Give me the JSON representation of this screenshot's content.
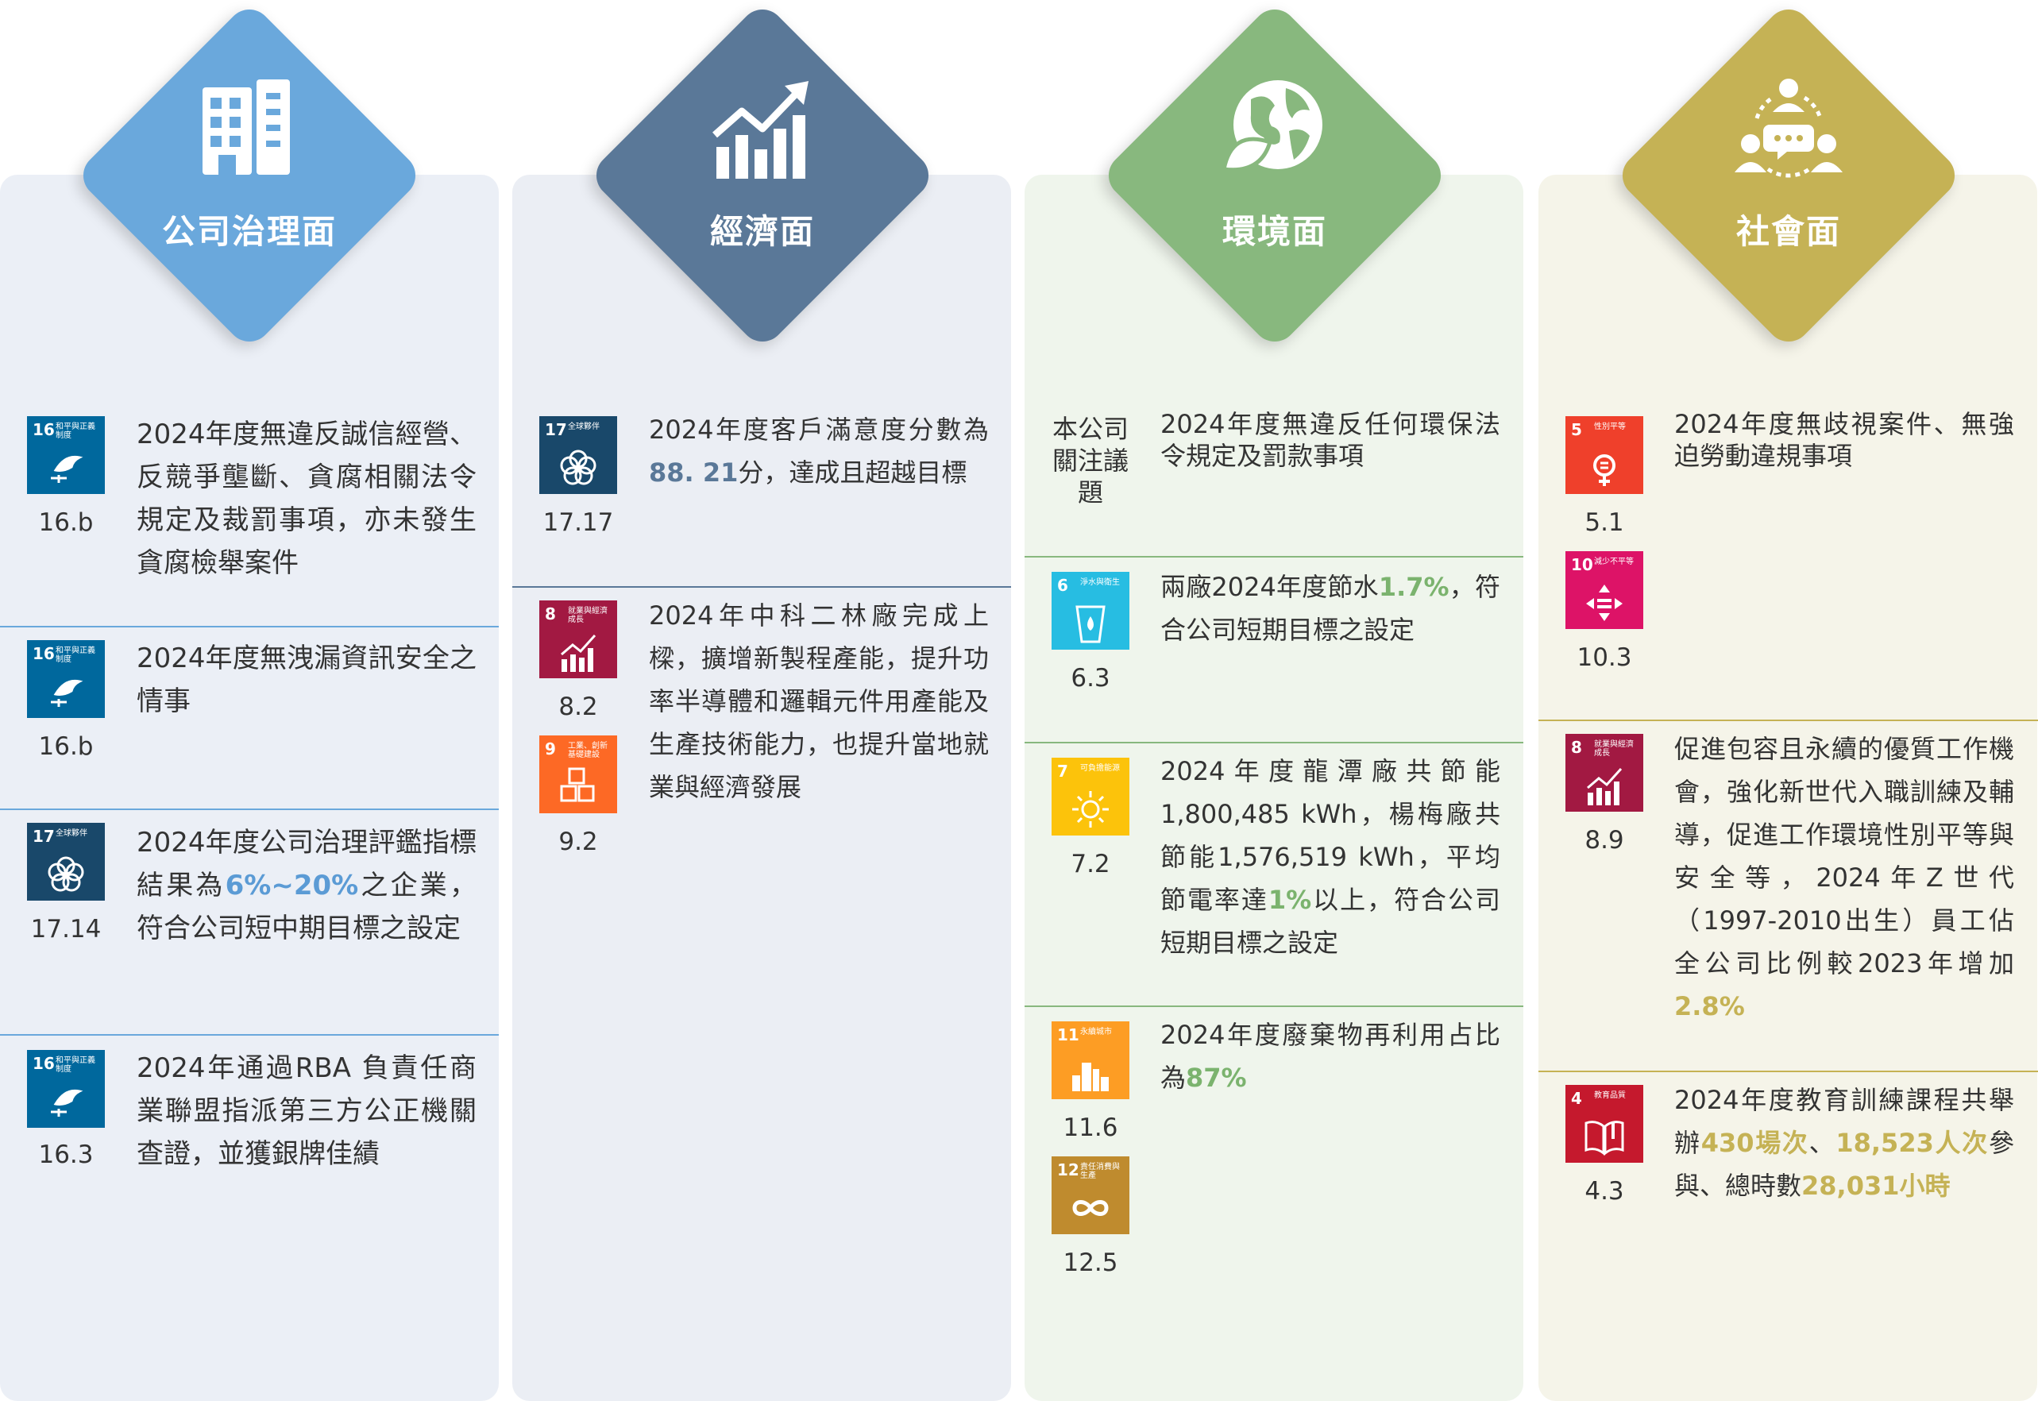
{
  "colors": {
    "governance": "#6aa8dc",
    "economy": "#5a7898",
    "environment": "#88b87e",
    "society": "#c5b255",
    "panel_gov": "#ebeff6",
    "panel_econ": "#ebeef4",
    "panel_env": "#eff5ec",
    "panel_soc": "#f5f4e9",
    "sdg4": "#c5192d",
    "sdg5": "#ef402b",
    "sdg6": "#27bde2",
    "sdg7": "#fcc30b",
    "sdg8": "#a21942",
    "sdg9": "#fd6925",
    "sdg10": "#dd1367",
    "sdg11": "#fd9d24",
    "sdg12": "#bf8b2e",
    "sdg16": "#00689d",
    "sdg17": "#19486a"
  },
  "columns": {
    "governance": {
      "title": "公司治理面",
      "icon": "building-icon",
      "items": [
        {
          "text_pre": "2024年度無違反誠信經營、反競爭壟斷、貪腐相關法令規定及裁罰事項，亦未發生貪腐檢舉案件",
          "code": "16.b",
          "badge": {
            "num": "16",
            "name": "和平與正義制度"
          }
        },
        {
          "text_pre": "2024年度無洩漏資訊安全之情事",
          "code": "16.b",
          "badge": {
            "num": "16",
            "name": "和平與正義制度"
          }
        },
        {
          "text_pre": "2024年度公司治理評鑑指標結果為",
          "highlight": "6%~20%",
          "text_post": "之企業，符合公司短中期目標之設定",
          "code": "17.14",
          "badge": {
            "num": "17",
            "name": "全球夥伴"
          }
        },
        {
          "text_pre": "2024年通過RBA 負責任商業聯盟指派第三方公正機關查證，並獲銀牌佳績",
          "code": "16.3",
          "badge": {
            "num": "16",
            "name": "和平與正義制度"
          }
        }
      ]
    },
    "economy": {
      "title": "經濟面",
      "icon": "growth-chart-icon",
      "items": [
        {
          "text_pre": "2024年度客戶滿意度分數為",
          "highlight": "88. 21",
          "text_post": "分，達成且超越目標",
          "codes": [
            "17.17"
          ],
          "badges": [
            {
              "num": "17",
              "name": "全球夥伴"
            }
          ]
        },
        {
          "text_pre": "2024年中科二林廠完成上樑，擴增新製程產能，提升功率半導體和邏輯元件用產能及生產技術能力，也提升當地就業與經濟發展",
          "codes": [
            "8.2",
            "9.2"
          ],
          "badges": [
            {
              "num": "8",
              "name": "就業與經濟成長"
            },
            {
              "num": "9",
              "name": "工業、創新基礎建設"
            }
          ]
        }
      ]
    },
    "environment": {
      "title": "環境面",
      "icon": "earth-leaf-icon",
      "items": [
        {
          "note": "本公司關注議題",
          "text_pre": "2024年度無違反任何環保法令規定及罰款事項"
        },
        {
          "text_pre": "兩廠2024年度節水",
          "highlight": "1.7%",
          "text_post": "，符合公司短期目標之設定",
          "codes": [
            "6.3"
          ],
          "badges": [
            {
              "num": "6",
              "name": "淨水與衛生"
            }
          ]
        },
        {
          "text_pre": "2024年度龍潭廠共節能1,800,485 kWh，楊梅廠共節能1,576,519 kWh，平均節電率達",
          "highlight": "1%",
          "text_post": "以上，符合公司短期目標之設定",
          "codes": [
            "7.2"
          ],
          "badges": [
            {
              "num": "7",
              "name": "可負擔能源"
            }
          ]
        },
        {
          "text_pre": "2024年度廢棄物再利用占比為",
          "highlight": "87%",
          "text_post": "",
          "codes": [
            "11.6",
            "12.5"
          ],
          "badges": [
            {
              "num": "11",
              "name": "永續城市"
            },
            {
              "num": "12",
              "name": "責任消費與生產"
            }
          ]
        }
      ]
    },
    "society": {
      "title": "社會面",
      "icon": "community-icon",
      "items": [
        {
          "text_pre": "2024年度無歧視案件、無強迫勞動違規事項",
          "codes": [
            "5.1",
            "10.3"
          ],
          "badges": [
            {
              "num": "5",
              "name": "性別平等"
            },
            {
              "num": "10",
              "name": "減少不平等"
            }
          ]
        },
        {
          "text_pre": "促進包容且永續的優質工作機會，強化新世代入職訓練及輔導，促進工作環境性別平等與安全等，2024年Z世代（1997-2010出生）員工佔全公司比例較2023年增加",
          "highlight": "2.8%",
          "text_post": "",
          "codes": [
            "8.9"
          ],
          "badges": [
            {
              "num": "8",
              "name": "就業與經濟成長"
            }
          ]
        },
        {
          "text_pre": "2024年度教育訓練課程共舉辦",
          "highlight": "430場次",
          "text_mid": "、",
          "highlight2": "18,523人次",
          "text_mid2": "參與、總時數",
          "highlight3": "28,031小時",
          "text_post": "",
          "codes": [
            "4.3"
          ],
          "badges": [
            {
              "num": "4",
              "name": "教育品質"
            }
          ]
        }
      ]
    }
  }
}
